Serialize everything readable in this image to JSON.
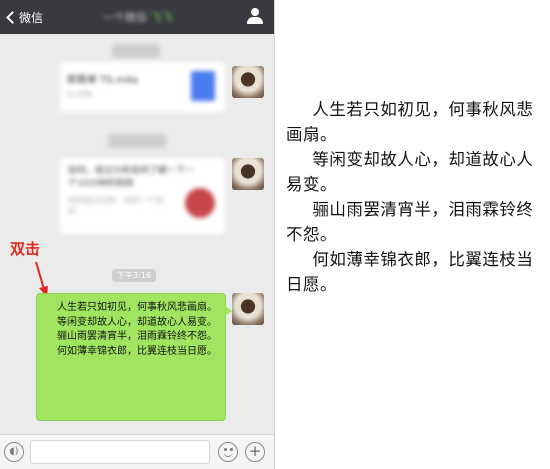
{
  "header": {
    "back_label": "微信",
    "title": "一个微信·",
    "title_accent": "飞飞"
  },
  "icons": {
    "back": "chevron-left-icon",
    "user": "person-icon",
    "voice": "voice-icon",
    "emoji": "emoji-icon",
    "plus": "plus-icon"
  },
  "messages": {
    "card1": {
      "title": "新歌单 TS.m4a",
      "subtitle": "8.1MB"
    },
    "card2": {
      "title": "如何，经过分析如何了解一下一个10分钟的视频",
      "subtitle": "如何经过分析，如何一个好的"
    },
    "timestamp": "下午3:16",
    "bubble_lines": [
      "人生若只如初见，何事秋风悲画扇。",
      "等闲变却故人心，却道故心人易变。",
      "骊山雨罢清宵半，泪雨霖铃终不怨。",
      "何如薄幸锦衣郎，比翼连枝当日愿。"
    ]
  },
  "annotation": {
    "label": "双击",
    "color": "#e0281e"
  },
  "input": {
    "value": ""
  },
  "poem": {
    "lines": [
      "人生若只如初见，何事秋风悲画扇。",
      "等闲变却故人心，却道故心人易变。",
      "骊山雨罢清宵半，泪雨霖铃终不怨。",
      "何如薄幸锦衣郎，比翼连枝当日愿。"
    ]
  },
  "colors": {
    "nav_bg": "#393a3f",
    "chat_bg": "#ebebeb",
    "bubble_green": "#9fe55f"
  }
}
